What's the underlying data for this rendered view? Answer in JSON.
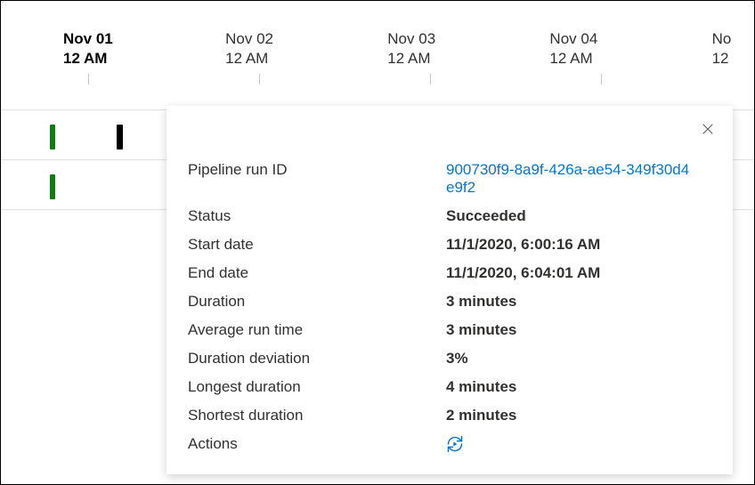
{
  "timeline": {
    "dates": [
      {
        "day": "Nov 01",
        "time": "12 AM",
        "active": true
      },
      {
        "day": "Nov 02",
        "time": "12 AM",
        "active": false
      },
      {
        "day": "Nov 03",
        "time": "12 AM",
        "active": false
      },
      {
        "day": "Nov 04",
        "time": "12 AM",
        "active": false
      },
      {
        "day": "No",
        "time": "12",
        "active": false
      }
    ]
  },
  "panel": {
    "run_id_label": "Pipeline run ID",
    "run_id": "900730f9-8a9f-426a-ae54-349f30d4e9f2",
    "status_label": "Status",
    "status": "Succeeded",
    "start_label": "Start date",
    "start": "11/1/2020, 6:00:16 AM",
    "end_label": "End date",
    "end": "11/1/2020, 6:04:01 AM",
    "duration_label": "Duration",
    "duration": "3 minutes",
    "avg_label": "Average run time",
    "avg": "3 minutes",
    "deviation_label": "Duration deviation",
    "deviation": "3%",
    "longest_label": "Longest duration",
    "longest": "4 minutes",
    "shortest_label": "Shortest duration",
    "shortest": "2 minutes",
    "actions_label": "Actions"
  }
}
